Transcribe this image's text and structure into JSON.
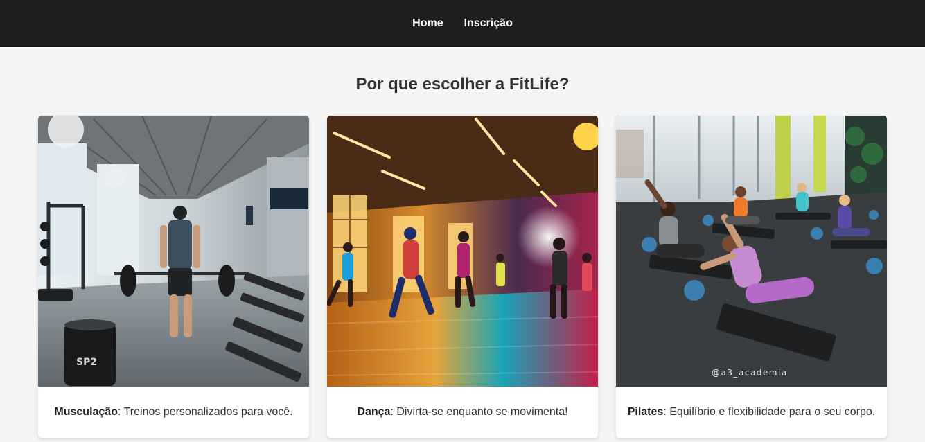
{
  "nav": {
    "items": [
      {
        "label": "Home"
      },
      {
        "label": "Inscrição"
      }
    ]
  },
  "section": {
    "title": "Por que escolher a FitLife?"
  },
  "cards": [
    {
      "name": "Musculação",
      "description": ": Treinos personalizados para você.",
      "photo": "gym-weights-photo"
    },
    {
      "name": "Dança",
      "description": ": Divirta-se enquanto se movimenta!",
      "photo": "dance-class-photo"
    },
    {
      "name": "Pilates",
      "description": ": Equilíbrio e flexibilidade para o seu corpo.",
      "photo": "pilates-class-photo",
      "watermark": "@a3_academia"
    }
  ],
  "colors": {
    "nav_background": "#1f1f1f",
    "page_background": "#f4f4f4",
    "title_text": "#333333"
  }
}
